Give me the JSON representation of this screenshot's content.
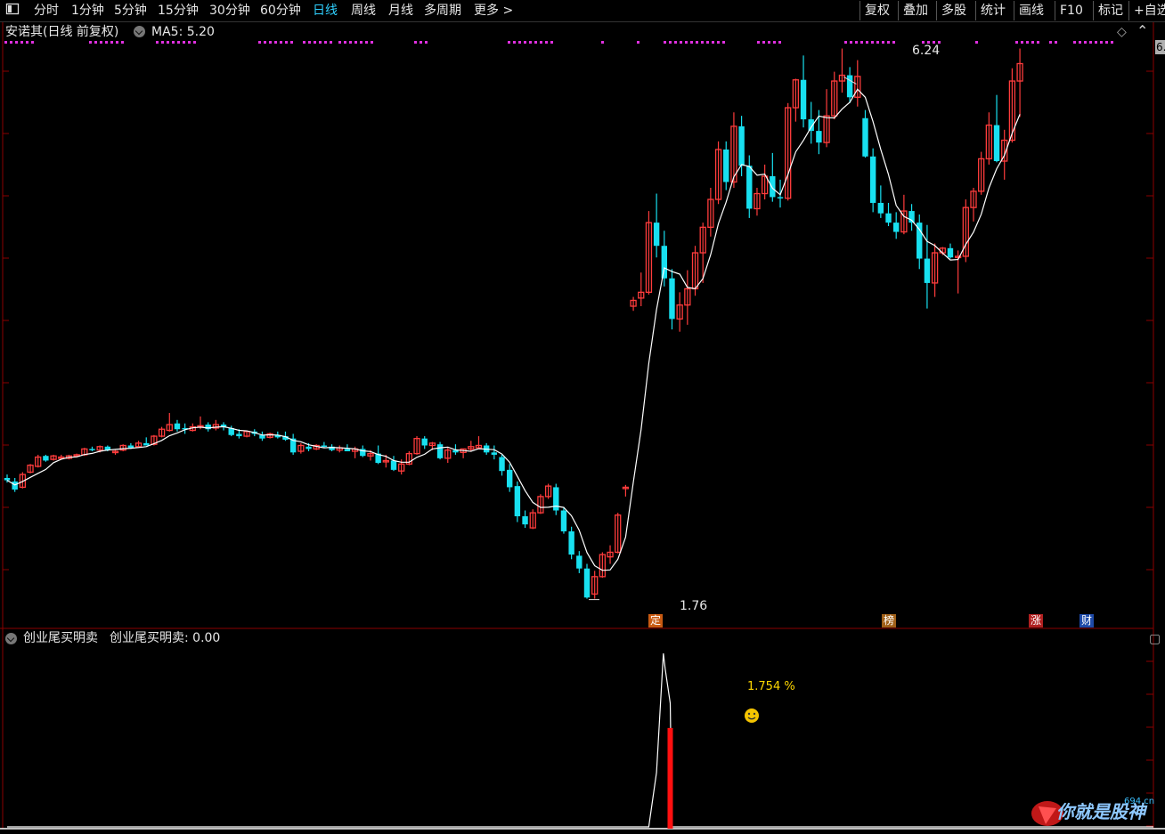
{
  "toolbar": {
    "left_items": [
      "分时",
      "1分钟",
      "5分钟",
      "15分钟",
      "30分钟",
      "60分钟",
      "日线",
      "周线",
      "月线",
      "多周期",
      "更多 >"
    ],
    "active": "日线",
    "right_items": [
      "复权",
      "叠加",
      "多股",
      "统计",
      "画线",
      "F10",
      "标记",
      "+自选"
    ]
  },
  "main_panel": {
    "title": "安诺其(日线 前复权)",
    "ma_label": "MA5: 5.20",
    "high_label": "6.24",
    "low_label": "1.76",
    "right_edge_label": "6.",
    "event_badges": [
      "定",
      "榜",
      "涨",
      "财"
    ],
    "colors": {
      "up": "#ff3c3c",
      "down": "#18e0f0",
      "ma": "#ffffff",
      "dots": "#e030e0"
    }
  },
  "indicator_panel": {
    "title": "创业尾买明卖",
    "value_label": "创业尾买明卖: 0.00",
    "peak_label": "1.754 %",
    "colors": {
      "line": "#ffffff",
      "bar": "#ff1010",
      "label": "#ffd700"
    }
  },
  "watermark": {
    "text": "你就是股神",
    "site": "694.cn"
  },
  "chart_data": {
    "type": "candlestick",
    "ohlc": [
      [
        2.8,
        2.83,
        2.76,
        2.78
      ],
      [
        2.77,
        2.8,
        2.68,
        2.7
      ],
      [
        2.72,
        2.85,
        2.71,
        2.83
      ],
      [
        2.85,
        2.92,
        2.84,
        2.91
      ],
      [
        2.9,
        3.0,
        2.89,
        2.98
      ],
      [
        2.99,
        3.0,
        2.94,
        2.95
      ],
      [
        2.96,
        3.0,
        2.95,
        2.99
      ],
      [
        2.98,
        3.0,
        2.96,
        2.98
      ],
      [
        2.97,
        3.0,
        2.96,
        2.99
      ],
      [
        2.99,
        3.01,
        2.98,
        3.0
      ],
      [
        3.0,
        3.06,
        2.99,
        3.05
      ],
      [
        3.05,
        3.07,
        3.03,
        3.04
      ],
      [
        3.04,
        3.08,
        3.02,
        3.07
      ],
      [
        3.07,
        3.08,
        3.03,
        3.04
      ],
      [
        3.03,
        3.04,
        3.0,
        3.03
      ],
      [
        3.04,
        3.09,
        3.03,
        3.08
      ],
      [
        3.08,
        3.1,
        3.05,
        3.06
      ],
      [
        3.07,
        3.12,
        3.06,
        3.1
      ],
      [
        3.1,
        3.15,
        3.08,
        3.08
      ],
      [
        3.09,
        3.17,
        3.08,
        3.16
      ],
      [
        3.16,
        3.24,
        3.15,
        3.22
      ],
      [
        3.21,
        3.36,
        3.2,
        3.26
      ],
      [
        3.27,
        3.3,
        3.2,
        3.22
      ],
      [
        3.23,
        3.27,
        3.18,
        3.22
      ],
      [
        3.21,
        3.27,
        3.2,
        3.24
      ],
      [
        3.24,
        3.33,
        3.22,
        3.25
      ],
      [
        3.26,
        3.28,
        3.2,
        3.22
      ],
      [
        3.23,
        3.3,
        3.21,
        3.26
      ],
      [
        3.26,
        3.28,
        3.21,
        3.24
      ],
      [
        3.23,
        3.25,
        3.16,
        3.17
      ],
      [
        3.18,
        3.22,
        3.14,
        3.16
      ],
      [
        3.16,
        3.21,
        3.15,
        3.2
      ],
      [
        3.2,
        3.22,
        3.16,
        3.18
      ],
      [
        3.17,
        3.2,
        3.12,
        3.14
      ],
      [
        3.15,
        3.19,
        3.14,
        3.18
      ],
      [
        3.17,
        3.2,
        3.14,
        3.15
      ],
      [
        3.16,
        3.2,
        3.12,
        3.13
      ],
      [
        3.14,
        3.18,
        3.0,
        3.02
      ],
      [
        3.03,
        3.1,
        3.01,
        3.08
      ],
      [
        3.07,
        3.1,
        3.03,
        3.05
      ],
      [
        3.05,
        3.09,
        3.04,
        3.08
      ],
      [
        3.08,
        3.11,
        3.06,
        3.07
      ],
      [
        3.07,
        3.09,
        3.03,
        3.04
      ],
      [
        3.04,
        3.08,
        3.02,
        3.06
      ],
      [
        3.05,
        3.09,
        3.03,
        3.03
      ],
      [
        3.03,
        3.07,
        2.97,
        3.05
      ],
      [
        3.05,
        3.08,
        2.98,
        2.99
      ],
      [
        2.99,
        3.04,
        2.95,
        3.01
      ],
      [
        3.01,
        3.08,
        2.92,
        2.93
      ],
      [
        2.94,
        3.0,
        2.89,
        2.95
      ],
      [
        2.95,
        2.99,
        2.86,
        2.87
      ],
      [
        2.86,
        2.96,
        2.83,
        2.92
      ],
      [
        2.92,
        3.03,
        2.91,
        3.01
      ],
      [
        3.01,
        3.16,
        3.0,
        3.14
      ],
      [
        3.14,
        3.16,
        3.05,
        3.08
      ],
      [
        3.08,
        3.11,
        3.04,
        3.1
      ],
      [
        3.09,
        3.11,
        2.96,
        2.97
      ],
      [
        2.97,
        3.06,
        2.93,
        3.04
      ],
      [
        3.04,
        3.09,
        3.0,
        3.02
      ],
      [
        3.02,
        3.05,
        2.97,
        3.05
      ],
      [
        3.05,
        3.12,
        3.03,
        3.07
      ],
      [
        3.06,
        3.16,
        3.05,
        3.08
      ],
      [
        3.08,
        3.1,
        3.0,
        3.02
      ],
      [
        3.02,
        3.08,
        2.96,
        3.0
      ],
      [
        2.98,
        3.0,
        2.82,
        2.86
      ],
      [
        2.87,
        2.92,
        2.68,
        2.72
      ],
      [
        2.73,
        2.77,
        2.42,
        2.47
      ],
      [
        2.47,
        2.52,
        2.37,
        2.4
      ],
      [
        2.37,
        2.53,
        2.36,
        2.5
      ],
      [
        2.5,
        2.66,
        2.49,
        2.64
      ],
      [
        2.64,
        2.75,
        2.62,
        2.73
      ],
      [
        2.72,
        2.75,
        2.48,
        2.52
      ],
      [
        2.52,
        2.55,
        2.32,
        2.34
      ],
      [
        2.34,
        2.38,
        2.1,
        2.14
      ],
      [
        2.13,
        2.17,
        1.98,
        2.02
      ],
      [
        2.02,
        2.06,
        1.76,
        1.77
      ],
      [
        1.8,
        2.0,
        1.76,
        1.95
      ],
      [
        1.95,
        2.16,
        1.94,
        2.14
      ],
      [
        2.12,
        2.22,
        2.06,
        2.16
      ],
      [
        2.16,
        2.5,
        2.15,
        2.48
      ],
      [
        2.72,
        2.74,
        2.64,
        2.72
      ],
      [
        4.28,
        4.36,
        4.24,
        4.33
      ],
      [
        4.35,
        4.57,
        4.28,
        4.4
      ],
      [
        4.4,
        5.1,
        4.38,
        5.0
      ],
      [
        5.0,
        5.25,
        4.7,
        4.8
      ],
      [
        4.8,
        4.93,
        4.45,
        4.52
      ],
      [
        4.52,
        4.6,
        4.08,
        4.17
      ],
      [
        4.17,
        4.4,
        4.06,
        4.29
      ],
      [
        4.29,
        4.59,
        4.12,
        4.43
      ],
      [
        4.43,
        4.8,
        4.37,
        4.74
      ],
      [
        4.74,
        5.0,
        4.48,
        4.96
      ],
      [
        4.96,
        5.3,
        4.88,
        5.2
      ],
      [
        5.2,
        5.7,
        5.16,
        5.63
      ],
      [
        5.63,
        5.7,
        5.28,
        5.35
      ],
      [
        5.35,
        5.95,
        5.3,
        5.83
      ],
      [
        5.83,
        5.92,
        5.4,
        5.49
      ],
      [
        5.49,
        5.58,
        5.04,
        5.12
      ],
      [
        5.12,
        5.3,
        5.06,
        5.25
      ],
      [
        5.25,
        5.5,
        5.2,
        5.4
      ],
      [
        5.4,
        5.6,
        5.18,
        5.22
      ],
      [
        5.22,
        5.37,
        5.13,
        5.21
      ],
      [
        5.21,
        6.03,
        5.19,
        5.99
      ],
      [
        5.99,
        6.24,
        5.87,
        6.23
      ],
      [
        6.23,
        6.44,
        5.82,
        5.89
      ],
      [
        5.89,
        6.04,
        5.68,
        5.79
      ],
      [
        5.79,
        5.97,
        5.59,
        5.69
      ],
      [
        5.69,
        6.15,
        5.65,
        5.92
      ],
      [
        5.92,
        6.3,
        5.89,
        6.22
      ],
      [
        6.22,
        6.5,
        6.12,
        6.27
      ],
      [
        6.27,
        6.34,
        6.03,
        6.08
      ],
      [
        6.08,
        6.4,
        6.0,
        6.26
      ],
      [
        5.9,
        5.97,
        5.56,
        5.57
      ],
      [
        5.57,
        5.64,
        5.09,
        5.17
      ],
      [
        5.17,
        5.32,
        5.04,
        5.08
      ],
      [
        5.08,
        5.17,
        4.97,
        5.0
      ],
      [
        5.0,
        5.09,
        4.86,
        4.92
      ],
      [
        4.92,
        5.24,
        4.9,
        5.1
      ],
      [
        5.1,
        5.16,
        4.93,
        5.0
      ],
      [
        5.0,
        5.07,
        4.6,
        4.69
      ],
      [
        4.69,
        4.98,
        4.26,
        4.48
      ],
      [
        4.48,
        4.82,
        4.36,
        4.74
      ],
      [
        4.74,
        4.79,
        4.72,
        4.78
      ],
      [
        4.78,
        4.82,
        4.69,
        4.7
      ],
      [
        4.7,
        4.76,
        4.39,
        4.71
      ],
      [
        4.71,
        5.2,
        4.66,
        5.13
      ],
      [
        5.13,
        5.3,
        5.01,
        5.27
      ],
      [
        5.27,
        5.61,
        5.24,
        5.55
      ],
      [
        5.55,
        5.95,
        5.5,
        5.84
      ],
      [
        5.84,
        6.1,
        5.52,
        5.53
      ],
      [
        5.53,
        5.8,
        5.37,
        5.71
      ],
      [
        5.71,
        6.33,
        5.69,
        6.22
      ],
      [
        6.22,
        6.5,
        5.91,
        6.37
      ]
    ],
    "ma5_label": "MA5: 5.20",
    "high": 6.24,
    "low": 1.76,
    "indicator": {
      "name": "创业尾买明卖",
      "peak": 1.754,
      "signal_value": 1.0
    }
  }
}
